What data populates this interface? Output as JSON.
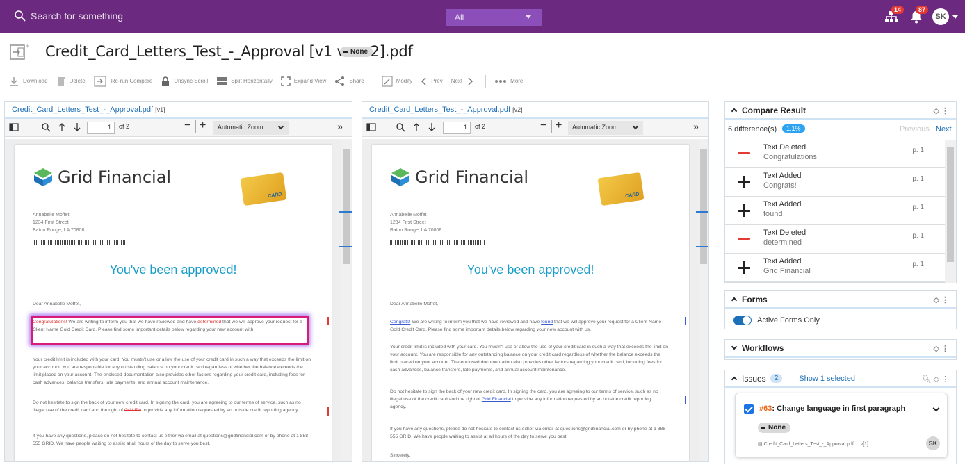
{
  "topbar": {
    "search_placeholder": "Search for something",
    "scope": "All",
    "network_badge": "14",
    "bell_badge": "87",
    "user_initials": "SK"
  },
  "title": {
    "filename": "Credit_Card_Letters_Test_-_Approval [v1 vs. v2].pdf",
    "status": "None"
  },
  "toolbar": {
    "download": "Download",
    "delete": "Delete",
    "rerun": "Re-run Compare",
    "unsync": "Unsync Scroll",
    "split": "Split Horizontally",
    "expand": "Expand View",
    "share": "Share",
    "modify": "Modify",
    "prev": "Prev",
    "next": "Next",
    "more": "More"
  },
  "left_panel": {
    "file": "Credit_Card_Letters_Test_-_Approval.pdf",
    "version": "[v1]",
    "page": "1",
    "of": "of 2",
    "zoom": "Automatic Zoom"
  },
  "right_panel": {
    "file": "Credit_Card_Letters_Test_-_Approval.pdf",
    "version": "[v2]",
    "page": "1",
    "of": "of 2",
    "zoom": "Automatic Zoom"
  },
  "letter": {
    "brand": "Grid Financial",
    "card_label": "CARD",
    "addr1": "Annabelle Moffet",
    "addr2": "1234 First Street",
    "addr3": "Baton Rouge, LA 70808",
    "headline": "You've been approved!",
    "salutation": "Dear Annabelle Moffet,",
    "p1_v1_del": "Congratulations!",
    "p1_v1_a": " We are writing to inform you that we have reviewed and have ",
    "p1_v1_del2": "determined",
    "p1_v1_b": " that we will approve your request for a Client Name Gold Credit Card. Please find some important details below regarding your new account with.",
    "p1_v2_add": "Congrats!",
    "p1_v2_a": " We are writing to inform you that we have reviewed and have ",
    "p1_v2_add2": "found",
    "p1_v2_b": " that we will approve your request for a Client Name Gold Credit Card. Please find some important details below regarding your new account with us.",
    "p2": "Your credit limit is included with your card. You mustn't use or allow the use of your credit card in such a way that exceeds the limit on your account. You are responsible for any outstanding balance on your credit card regardless of whether the balance exceeds the limit placed on your account. The enclosed documentation also provides other factors regarding your credit card, including fees for cash advances, balance transfers, late payments, and annual account maintenance.",
    "p3_a": "Do not hesitate to sign the back of your new credit card. In signing the card, you are agreeing to our terms of service, such as no illegal use of the credit card and the right of ",
    "p3_v1_del": "Grid Fin",
    "p3_v2_add": "Grid Financial",
    "p3_b": " to provide any information requested by an outside credit reporting agency.",
    "p4": "If you have any questions, please do not hesitate to contact us either via email at questions@gridfinancial.com or by phone at 1 888 555 GRID. We have people waiting to assist at all hours of the day to serve you best.",
    "closing": "Sincerely,"
  },
  "compare": {
    "header": "Compare Result",
    "count": "6 difference(s)",
    "pct": "1.1%",
    "previous": "Previous",
    "next": "Next",
    "items": [
      {
        "type": "Text Deleted",
        "value": "Congratulations!",
        "page": "p. 1",
        "kind": "minus"
      },
      {
        "type": "Text Added",
        "value": "Congrats!",
        "page": "p. 1",
        "kind": "plus"
      },
      {
        "type": "Text Added",
        "value": "found",
        "page": "p. 1",
        "kind": "plus"
      },
      {
        "type": "Text Deleted",
        "value": "determined",
        "page": "p. 1",
        "kind": "minus"
      },
      {
        "type": "Text Added",
        "value": "Grid Financial",
        "page": "p. 1",
        "kind": "plus"
      }
    ]
  },
  "forms": {
    "header": "Forms",
    "toggle_label": "Active Forms Only"
  },
  "workflows": {
    "header": "Workflows"
  },
  "issues": {
    "header": "Issues",
    "count": "2",
    "show_selected": "Show 1 selected",
    "card_id": "#63",
    "card_title": ": Change language in first paragraph",
    "card_status": "None",
    "card_file": "Credit_Card_Letters_Test_-_Approval.pdf",
    "card_version": "v[1]",
    "card_initials": "SK"
  }
}
